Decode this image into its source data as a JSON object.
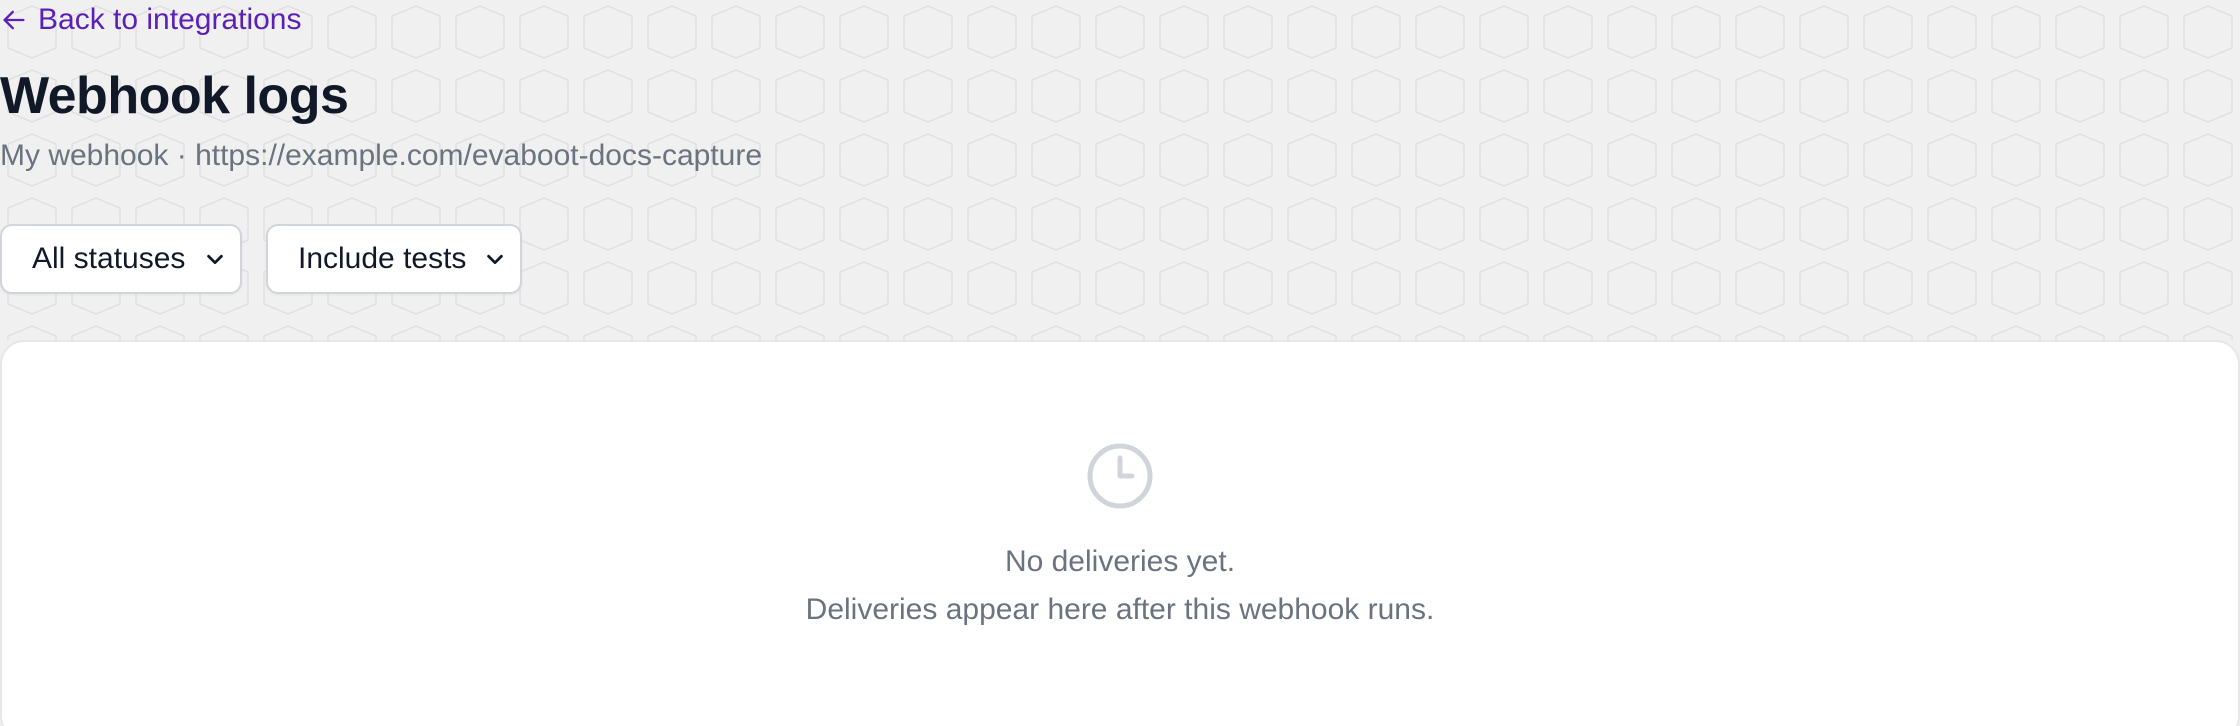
{
  "nav": {
    "back_label": "Back to integrations",
    "back_icon": "arrow-left-icon"
  },
  "header": {
    "title": "Webhook logs",
    "subtitle": "My webhook · https://example.com/evaboot-docs-capture"
  },
  "filters": {
    "status": {
      "selected": "All statuses",
      "icon": "chevron-down-icon"
    },
    "tests": {
      "selected": "Include tests",
      "icon": "chevron-down-icon"
    }
  },
  "empty_state": {
    "icon": "clock-icon",
    "title": "No deliveries yet.",
    "description": "Deliveries appear here after this webhook runs."
  },
  "colors": {
    "accent": "#5b21b6",
    "background": "#f0f0f0",
    "panel": "#ffffff",
    "muted_text": "#6b7280",
    "heading": "#111827",
    "icon_gray": "#d1d5db"
  }
}
